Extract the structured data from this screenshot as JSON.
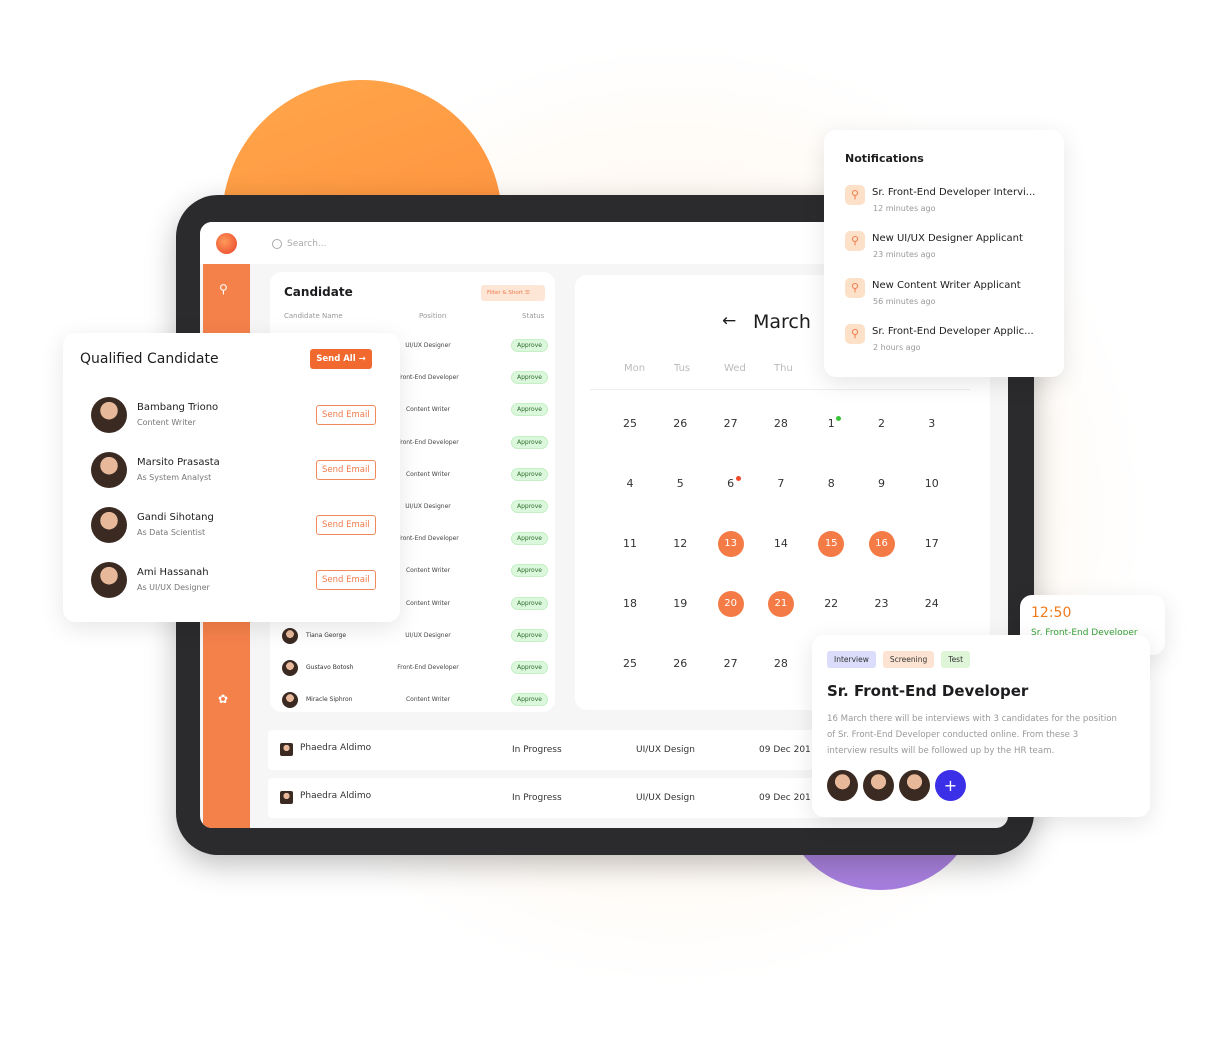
{
  "colors": {
    "accent": "#f47b45",
    "approve": "#dcf8dc",
    "plus": "#3b2fe8",
    "time": "#f07a1a",
    "time_sub": "#3aa53a"
  },
  "app": {
    "search_placeholder": "Search...",
    "logo": "brand-logo"
  },
  "candidate": {
    "title": "Candidate",
    "filter_label": "Filter & Short",
    "columns": [
      "Candidate Name",
      "Position",
      "Status"
    ],
    "rows": [
      {
        "name": "",
        "position": "UI/UX Designer",
        "status": "Approve"
      },
      {
        "name": "",
        "position": "Front-End Developer",
        "status": "Approve"
      },
      {
        "name": "",
        "position": "Content Writer",
        "status": "Approve"
      },
      {
        "name": "",
        "position": "Front-End Developer",
        "status": "Approve"
      },
      {
        "name": "",
        "position": "Content Writer",
        "status": "Approve"
      },
      {
        "name": "",
        "position": "UI/UX Designer",
        "status": "Approve"
      },
      {
        "name": "",
        "position": "Front-End Developer",
        "status": "Approve"
      },
      {
        "name": "",
        "position": "Content Writer",
        "status": "Approve"
      },
      {
        "name": "",
        "position": "Content Writer",
        "status": "Approve"
      },
      {
        "name": "Tiana George",
        "position": "UI/UX Designer",
        "status": "Approve"
      },
      {
        "name": "Gustavo Botosh",
        "position": "Front-End Developer",
        "status": "Approve"
      },
      {
        "name": "Miracle Siphron",
        "position": "Content Writer",
        "status": "Approve"
      }
    ]
  },
  "calendar": {
    "month": "March",
    "weekdays": [
      "Mon",
      "Tus",
      "Wed",
      "Thu"
    ],
    "weeks": [
      [
        "25",
        "26",
        "27",
        "28",
        "1",
        "2",
        "3"
      ],
      [
        "4",
        "5",
        "6",
        "7",
        "8",
        "9",
        "10"
      ],
      [
        "11",
        "12",
        "13",
        "14",
        "15",
        "16",
        "17"
      ],
      [
        "18",
        "19",
        "20",
        "21",
        "22",
        "23",
        "24"
      ],
      [
        "25",
        "26",
        "27",
        "28"
      ]
    ],
    "highlighted": [
      "13",
      "15",
      "16",
      "20",
      "21"
    ],
    "dot_green": "1",
    "dot_red": "6"
  },
  "bottom_rows": [
    {
      "name": "Phaedra Aldimo",
      "status": "In Progress",
      "dept": "UI/UX Design",
      "date": "09 Dec 201"
    },
    {
      "name": "Phaedra Aldimo",
      "status": "In Progress",
      "dept": "UI/UX Design",
      "date": "09 Dec 201"
    }
  ],
  "qualified": {
    "title": "Qualified Candidate",
    "send_all": "Send All",
    "items": [
      {
        "name": "Bambang Triono",
        "role": "Content Writer",
        "action": "Send Email"
      },
      {
        "name": "Marsito Prasasta",
        "role": "As System Analyst",
        "action": "Send Email"
      },
      {
        "name": "Gandi Sihotang",
        "role": "As Data Scientist",
        "action": "Send Email"
      },
      {
        "name": "Ami Hassanah",
        "role": "As UI/UX Designer",
        "action": "Send Email"
      }
    ]
  },
  "notifications": {
    "title": "Notifications",
    "items": [
      {
        "text": "Sr. Front-End Developer Intervi...",
        "time": "12 minutes ago"
      },
      {
        "text": "New UI/UX Designer Applicant",
        "time": "23 minutes ago"
      },
      {
        "text": "New Content Writer Applicant",
        "time": "56 minutes ago"
      },
      {
        "text": "Sr. Front-End Developer Applic...",
        "time": "2 hours ago"
      }
    ]
  },
  "time_card": {
    "time": "12:50",
    "label": "Sr. Front-End Developer"
  },
  "event": {
    "tags": [
      "Interview",
      "Screening",
      "Test"
    ],
    "title": "Sr. Front-End Developer",
    "description": "16 March  there will be interviews with 3 candidates for the position of Sr. Front-End Developer conducted online. From these 3 interview results will be followed up by the HR team.",
    "add": "+"
  }
}
